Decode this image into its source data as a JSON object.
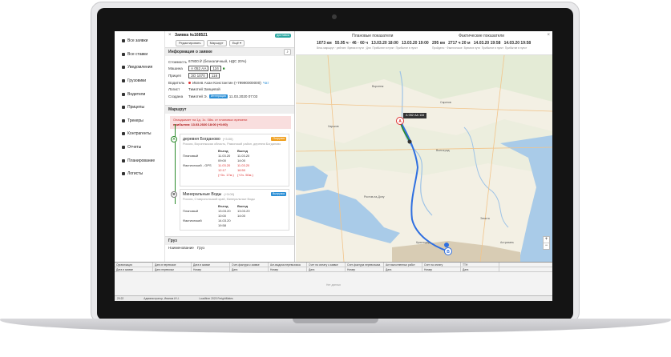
{
  "sidebar": {
    "items": [
      {
        "label": "Все заявки",
        "icon": "truck-icon"
      },
      {
        "label": "Все ставки",
        "icon": "bids-icon"
      },
      {
        "label": "Уведомления",
        "icon": "bell-icon"
      },
      {
        "label": "Грузовики",
        "icon": "truck-icon"
      },
      {
        "label": "Водители",
        "icon": "driver-icon"
      },
      {
        "label": "Прицепы",
        "icon": "trailer-icon"
      },
      {
        "label": "Трекеры",
        "icon": "tracker-icon"
      },
      {
        "label": "Контрагенты",
        "icon": "contractors-icon"
      },
      {
        "label": "Отчеты",
        "icon": "reports-icon"
      },
      {
        "label": "Планирование",
        "icon": "planning-icon"
      },
      {
        "label": "Логисты",
        "icon": "logists-icon"
      }
    ]
  },
  "panel": {
    "title": "Заявка №168521",
    "status_badge": "доставка",
    "tools": {
      "edit": "Редактировать",
      "route": "Маршрут",
      "more": "Ещё ▾"
    },
    "info_section": "Информация о заявке",
    "info": {
      "cost_label": "Стоимость",
      "cost_value": "67800 ₽ (безналичный, НДС 20%)",
      "truck_label": "Машина",
      "truck_plate": "А 052 АА",
      "truck_region": "116",
      "trailer_label": "Прицеп",
      "trailer_plate": "ЗО 1070",
      "trailer_region": "116",
      "driver_label": "Водитель",
      "driver_value": "Ивлев Ахан Константин (+79990000000)",
      "driver_chat": "Чат",
      "logist_label": "Логист",
      "logist_value": "Тимотей Заяцевой",
      "created_label": "Создана",
      "created_by": "Тимотей Э.",
      "created_source": "Интеграция",
      "created_at": "11.03.2020 07:03"
    },
    "route_section": "Маршрут",
    "alert_line1": "Опаздывает на 1д. 1ч. 08м. от плановых времени",
    "alert_line2": "прибытия: 13.03.2020 18:00 (+3:00)",
    "stops": [
      {
        "marker": "A",
        "name": "деревня Богданово",
        "tz": "(+3:00)",
        "tag": "Погрузка",
        "address": "Россия, Воронежская область, Рамонский район, деревня Богданово",
        "col_in": "Въезд",
        "col_out": "Выезд",
        "planned_label": "Плановый",
        "planned_in": "11.03.20 09:00",
        "planned_out": "11.03.20 14:00",
        "actual_label": "Фактический - GPS",
        "actual_in": "11.03.20 12:17",
        "actual_in_delta": "(+3ч. 17м.)",
        "actual_out": "11.03.20 16:50",
        "actual_out_delta": "(+2ч. 50м.)"
      },
      {
        "marker": "B",
        "name": "Минеральные Воды",
        "tz": "(+3:00)",
        "tag": "Выгрузка",
        "address": "Россия, Ставропольский край, Минеральные Воды",
        "col_in": "Въезд",
        "col_out": "Выезд",
        "planned_label": "Плановый",
        "planned_in": "13.03.20 10:00",
        "planned_out": "13.03.20 14:00",
        "actual_label": "Фактический",
        "actual_in": "14.03.20 19:58",
        "actual_out": ""
      }
    ],
    "cargo_section": "Груз",
    "cargo_label": "Наименование",
    "cargo_value": "Груз"
  },
  "plan": {
    "title": "Плановые показатели",
    "values": [
      "1073 км",
      "55.95 ч · 46 · 60 ч",
      "13.03.20 18:00",
      "13.03.20 19:00"
    ],
    "labels": [
      "Весь маршрут · рейтинг",
      "Время в пути · Дни",
      "Прибытие в пункт",
      "Прибытие в пункт"
    ]
  },
  "fact": {
    "title": "Фактические показатели",
    "values": [
      "295 км",
      "2717 ч 20 м",
      "14.03.20 19:58",
      "14.03.20 19:58"
    ],
    "labels": [
      "Пройдено · Фактическое",
      "Время в пути",
      "Прибытие в пункт",
      "Прибытие в пункт"
    ]
  },
  "map": {
    "tooltip": "А 052 АА 116",
    "marker_a": "A",
    "marker_b": "B",
    "zoom_in": "+",
    "zoom_out": "−"
  },
  "grid": {
    "headers": [
      "Организация",
      "Дата в перевозке",
      "Дата в заявке",
      "Счет-фактура к заявке",
      "Акт-выдача перевозчика",
      "Счет на оплату к заявке",
      "Счет-фактура перевозчика",
      "Акт выполненных работ",
      "Счет на оплату",
      "ТТН"
    ],
    "subheaders": [
      "Дата в заявке",
      "Дата перевозки",
      "Номер",
      "Дата",
      "Номер",
      "Дата",
      "Номер",
      "Дата",
      "Номер",
      "Дата"
    ],
    "empty": "Нет данных"
  },
  "status": {
    "items": [
      "20:22",
      "Администратор, Иванов И.Ч.",
      "Loadfiner 2020 FreightMates"
    ]
  },
  "colors": {
    "route": "#2f6fe0",
    "track": "#2a8a2a",
    "badge": "#2aa6a0",
    "alert_bg": "#f9dede"
  }
}
